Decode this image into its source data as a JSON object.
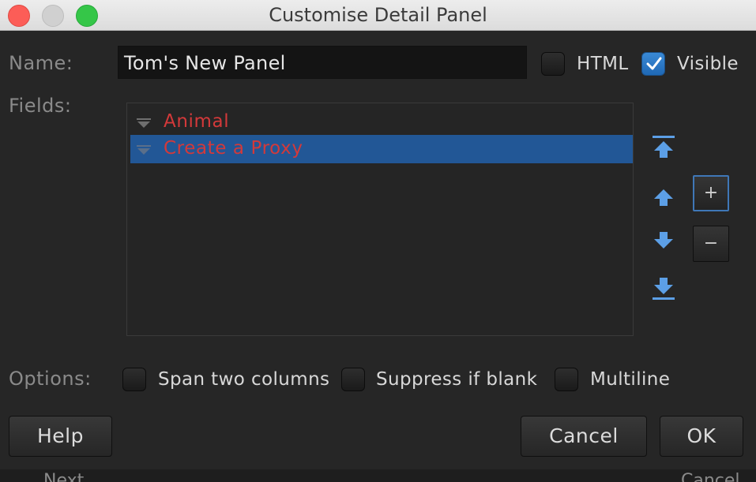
{
  "window": {
    "title": "Customise Detail Panel"
  },
  "name_row": {
    "label": "Name:",
    "value": "Tom's New Panel",
    "html_label": "HTML",
    "html_checked": false,
    "visible_label": "Visible",
    "visible_checked": true
  },
  "fields": {
    "label": "Fields:",
    "items": [
      {
        "label": "Animal",
        "selected": false
      },
      {
        "label": "Create a Proxy",
        "selected": true
      }
    ],
    "controls": {
      "move_top_icon": "move-to-top-icon",
      "move_up_icon": "move-up-icon",
      "move_down_icon": "move-down-icon",
      "move_bottom_icon": "move-to-bottom-icon",
      "add_label": "+",
      "remove_label": "−"
    }
  },
  "options": {
    "label": "Options:",
    "items": [
      {
        "label": "Span two columns",
        "checked": false
      },
      {
        "label": "Suppress if blank",
        "checked": false
      },
      {
        "label": "Multiline",
        "checked": false
      }
    ]
  },
  "buttons": {
    "help": "Help",
    "cancel": "Cancel",
    "ok": "OK"
  },
  "background_window": {
    "left_text": "Next",
    "right_text": "Cancel"
  },
  "colors": {
    "accent": "#225796",
    "field_text": "#d3393a",
    "arrow_blue": "#5c9fe6"
  }
}
